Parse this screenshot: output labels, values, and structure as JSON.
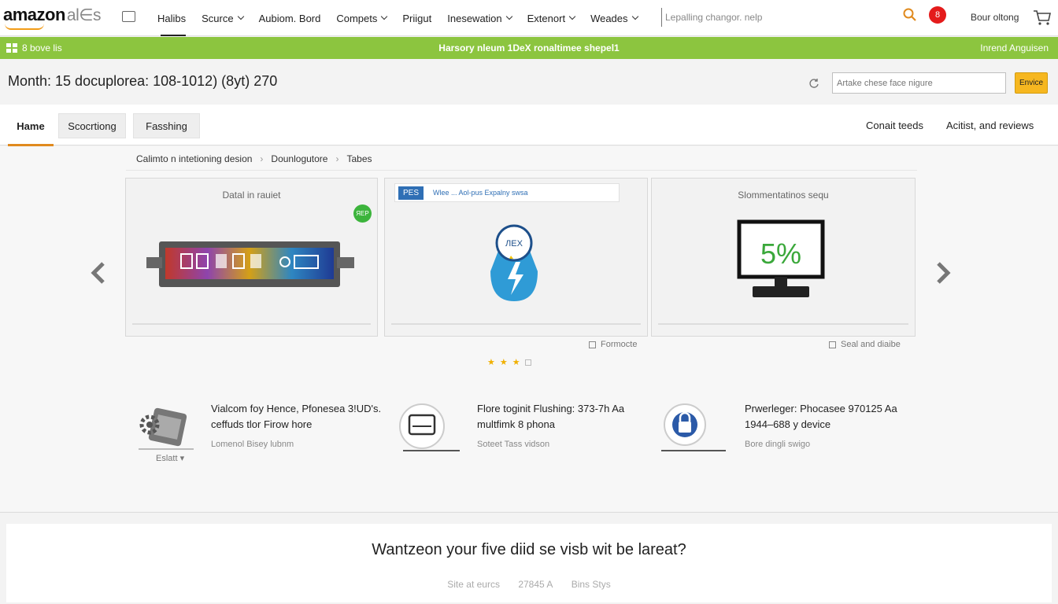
{
  "brand": {
    "logo": "amazon",
    "logo_suffix": "al∈s"
  },
  "nav": {
    "links": [
      {
        "label": "Halibs",
        "caret": false,
        "active": true
      },
      {
        "label": "Scurce",
        "caret": true,
        "active": false
      },
      {
        "label": "Aubiom. Bord",
        "caret": false,
        "active": false
      },
      {
        "label": "Compets",
        "caret": true,
        "active": false
      },
      {
        "label": "Priigut",
        "caret": false,
        "active": false
      },
      {
        "label": "Inesewation",
        "caret": true,
        "active": false
      },
      {
        "label": "Extenort",
        "caret": true,
        "active": false
      },
      {
        "label": "Weades",
        "caret": true,
        "active": false
      }
    ],
    "search_text": "Lepalling changor. nelp",
    "notification_count": "8",
    "signin_label": "Bour oltong"
  },
  "banner": {
    "left": "8 bove lis",
    "center": "Harsory nleum 1DeX ronaltimee shepel1",
    "right": "Inrend Anguisen"
  },
  "header": {
    "title": "Month: 15 docuplorea: 108-1012) (8yt) 270",
    "feature_placeholder": "Artake chese face nigure",
    "feature_button": "Envice"
  },
  "tabs": {
    "left": [
      {
        "label": "Hame"
      },
      {
        "label": "Scocrtiong"
      },
      {
        "label": "Fasshing"
      }
    ],
    "right": [
      {
        "label": "Conait teeds"
      },
      {
        "label": "Acitist, and reviews"
      }
    ]
  },
  "breadcrumb": [
    "Calimto n intetioning desion",
    "Dounlogutore",
    "Tabes"
  ],
  "carousel": {
    "cards": [
      {
        "caption": "Datal in rauiet",
        "badge": "ЯЕР"
      },
      {
        "header_tag": "PES",
        "header_text": "Wlee ... Aol-pus Expalny swsa",
        "icon_text": "ЛЕХ"
      },
      {
        "caption": "Slommentatinos sequ",
        "screen_text": "5%"
      }
    ],
    "footer_labels": [
      "Formocte",
      "Seal and diaibe"
    ]
  },
  "features": [
    {
      "title": "Vialcom foy Hence, Pfonesea 3!UD's. ceffuds tlor Firow hore",
      "sub": "Lomenol Bisey lubnm",
      "icon_label": "Eslatt",
      "icon": "gear-panel-icon"
    },
    {
      "title": "Flore toginit Flushing: 373-7h Aa multfimk 8 phona",
      "sub": "Soteet Tass vidson",
      "icon": "laptop-circle-icon"
    },
    {
      "title": "Prwerleger: Phocasee 970125 Aa 1944–688 y device",
      "sub": "Bore dingli swigo",
      "icon": "lock-circle-icon"
    }
  ],
  "bottom": {
    "question": "Wantzeon your five diid se visb wit be lareat?",
    "links": [
      "Site at eurcs",
      "27845 A",
      "Bins Stys"
    ]
  }
}
